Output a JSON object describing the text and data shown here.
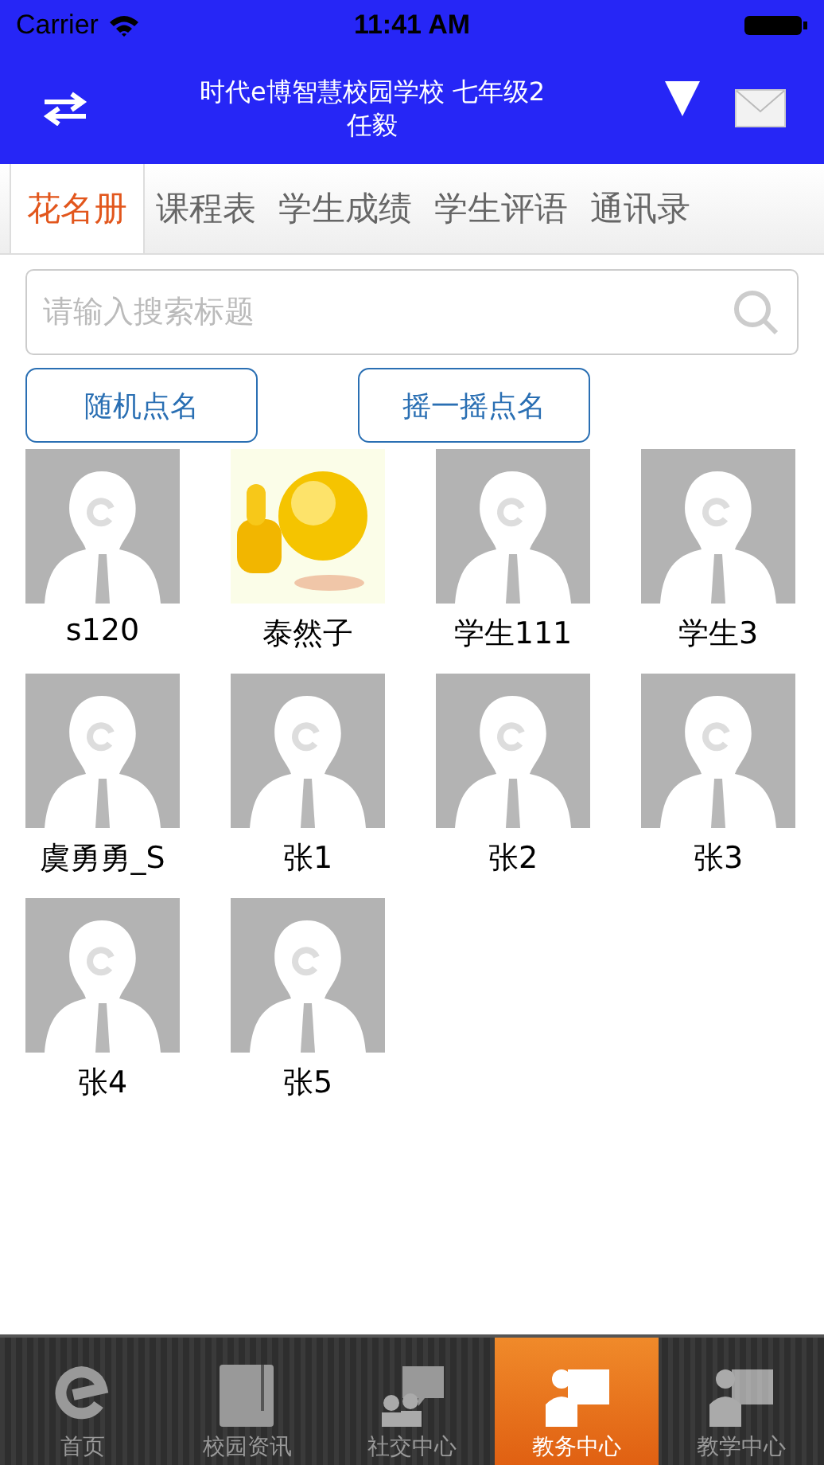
{
  "status_bar": {
    "carrier": "Carrier",
    "time": "11:41 AM"
  },
  "nav": {
    "title": "时代e博智慧校园学校 七年级2",
    "subtitle": "任毅"
  },
  "tabs": [
    {
      "label": "花名册",
      "selected": true
    },
    {
      "label": "课程表",
      "selected": false
    },
    {
      "label": "学生成绩",
      "selected": false
    },
    {
      "label": "学生评语",
      "selected": false
    },
    {
      "label": "通讯录",
      "selected": false
    }
  ],
  "search": {
    "placeholder": "请输入搜索标题"
  },
  "buttons": [
    "随机点名",
    "摇一摇点名"
  ],
  "students": [
    {
      "name": "s120",
      "kind": "default"
    },
    {
      "name": "泰然子",
      "kind": "picture"
    },
    {
      "name": "学生111",
      "kind": "default"
    },
    {
      "name": "学生3",
      "kind": "default"
    },
    {
      "name": "虞勇勇_S",
      "kind": "default"
    },
    {
      "name": "张1",
      "kind": "default"
    },
    {
      "name": "张2",
      "kind": "default"
    },
    {
      "name": "张3",
      "kind": "default"
    },
    {
      "name": "张4",
      "kind": "default"
    },
    {
      "name": "张5",
      "kind": "default"
    }
  ],
  "bottom_tabs": [
    {
      "label": "首页",
      "kind": "home",
      "selected": false
    },
    {
      "label": "校园资讯",
      "kind": "news",
      "selected": false
    },
    {
      "label": "社交中心",
      "kind": "social",
      "selected": false
    },
    {
      "label": "教务中心",
      "kind": "office",
      "selected": true
    },
    {
      "label": "教学中心",
      "kind": "office",
      "selected": false
    }
  ]
}
